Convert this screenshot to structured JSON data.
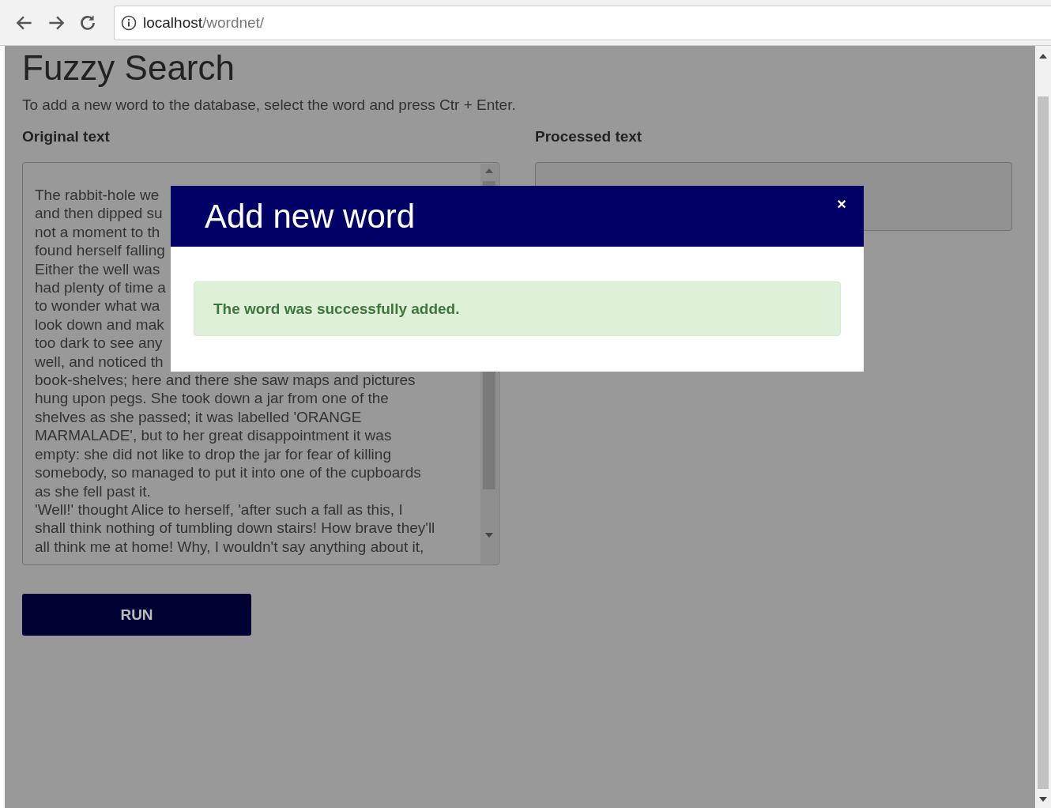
{
  "browser": {
    "address_host": "localhost",
    "address_path": "/wordnet/"
  },
  "page": {
    "title": "Fuzzy Search",
    "hint": "To add a new word to the database, select the word and press Ctr + Enter.",
    "original_label": "Original text",
    "processed_label": "Processed text",
    "original_text": [
      "The rabbit-hole we",
      "and then dipped su",
      "not a moment to th",
      "found herself falling",
      "Either the well was",
      "had plenty of time a",
      "to wonder what wa",
      "look down and mak",
      "too dark to see any",
      "well, and noticed th",
      "book-shelves; here and there she saw maps and pictures",
      "hung upon pegs. She took down a jar from one of the",
      "shelves as she passed; it was labelled 'ORANGE",
      "MARMALADE', but to her great disappointment it was",
      "empty: she did not like to drop the jar for fear of killing",
      "somebody, so managed to put it into one of the cupboards",
      "as she fell past it.",
      "'Well!' thought Alice to herself, 'after such a fall as this, I",
      "shall think nothing of tumbling down stairs! How brave they'll",
      "all think me at home! Why, I wouldn't say anything about it,"
    ],
    "run_button": "RUN"
  },
  "modal": {
    "title": "Add new word",
    "close": "×",
    "message": "The word was successfully added."
  }
}
